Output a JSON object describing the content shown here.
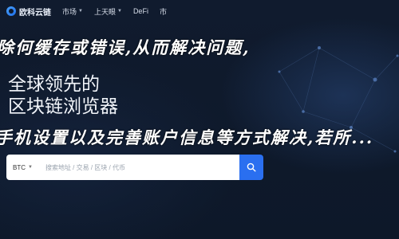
{
  "nav": {
    "logo_text": "欧科云链",
    "items": [
      {
        "label": "市场"
      },
      {
        "label": "上天眼"
      },
      {
        "label": "DeFi"
      },
      {
        "label": "市"
      }
    ]
  },
  "banner": {
    "line1": "除何缓存或错误,从而解决问题,",
    "line2": "手机设置以及完善账户信息等方式解决,若所..."
  },
  "hero": {
    "title_line1": "全球领先的",
    "title_line2": "区块链浏览器"
  },
  "search": {
    "coin": "BTC",
    "placeholder": "搜索地址 / 交易 / 区块 / 代币"
  }
}
